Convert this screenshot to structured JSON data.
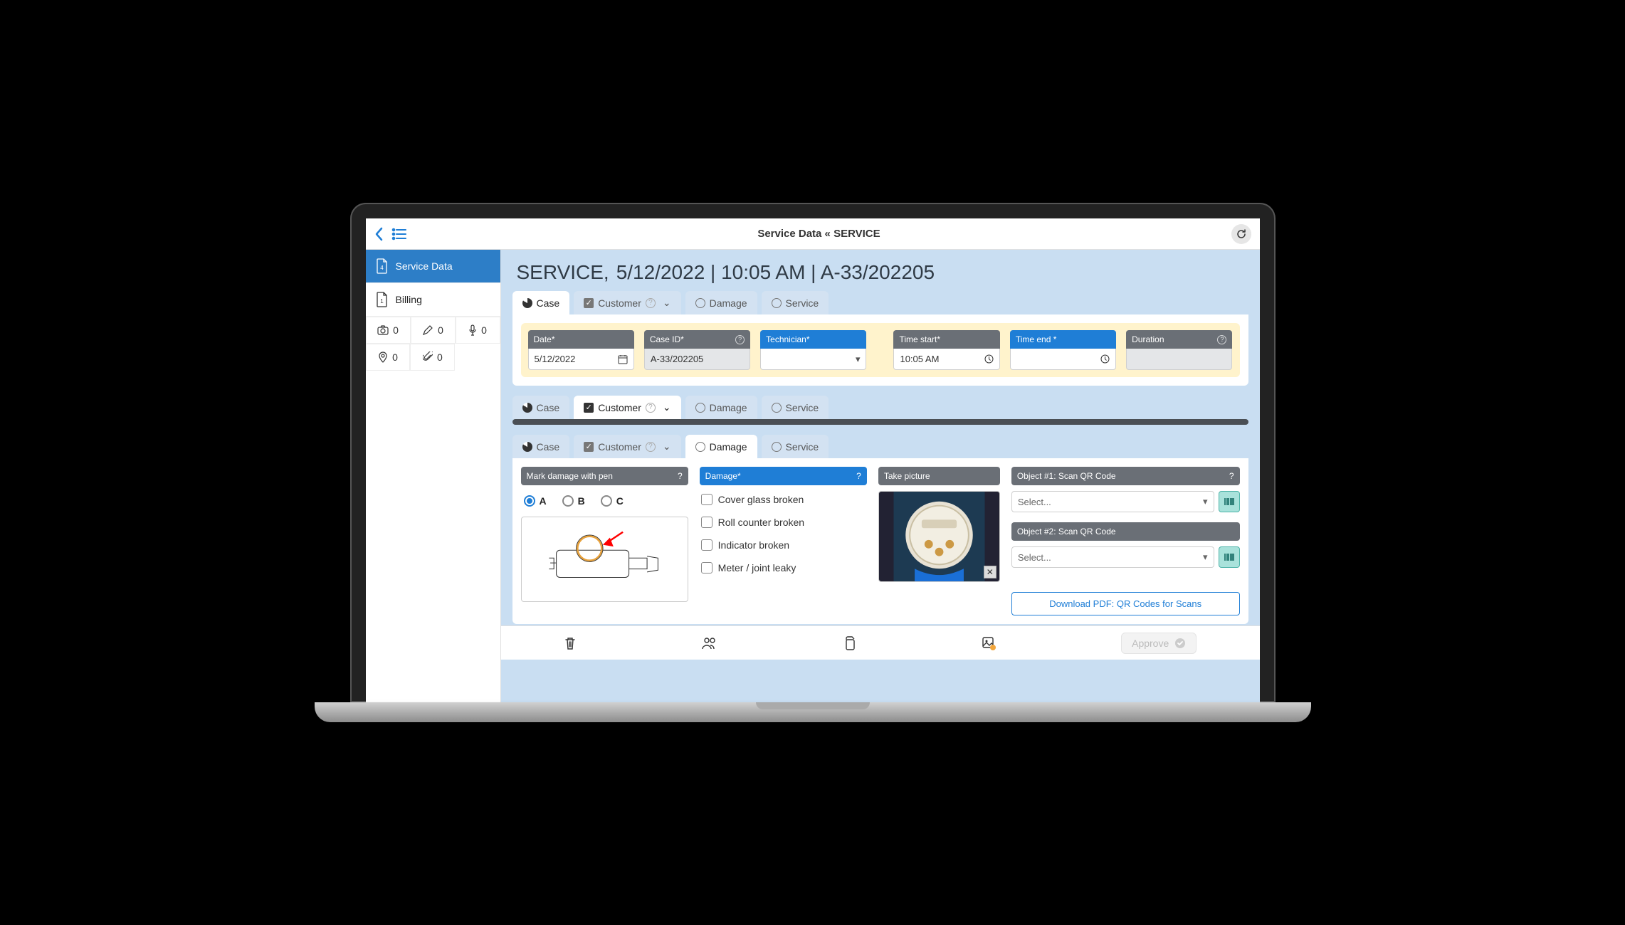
{
  "header": {
    "title": "Service Data « SERVICE"
  },
  "sidebar": {
    "items": [
      {
        "label": "Service Data",
        "doc_badge": "4"
      },
      {
        "label": "Billing",
        "doc_badge": "1"
      }
    ],
    "counters": {
      "camera": "0",
      "pen": "0",
      "mic": "0",
      "pin": "0",
      "clip": "0"
    }
  },
  "page": {
    "title_strong": "SERVICE,",
    "title_rest": "5/12/2022 | 10:05 AM | A-33/202205"
  },
  "tabs": {
    "case": "Case",
    "customer": "Customer",
    "damage": "Damage",
    "service": "Service"
  },
  "case_fields": {
    "date": {
      "label": "Date*",
      "value": "5/12/2022"
    },
    "case_id": {
      "label": "Case ID*",
      "value": "A-33/202205"
    },
    "technician": {
      "label": "Technician*",
      "value": ""
    },
    "time_start": {
      "label": "Time start*",
      "value": "10:05 AM"
    },
    "time_end": {
      "label": "Time end *",
      "value": ""
    },
    "duration": {
      "label": "Duration",
      "value": ""
    }
  },
  "damage": {
    "mark_label": "Mark damage with pen",
    "mark_options": [
      "A",
      "B",
      "C"
    ],
    "damage_label": "Damage*",
    "checks": [
      "Cover glass broken",
      "Roll counter broken",
      "Indicator broken",
      "Meter / joint leaky"
    ],
    "picture_label": "Take picture",
    "qr1_label": "Object #1: Scan QR Code",
    "qr2_label": "Object #2: Scan QR Code",
    "select_placeholder": "Select...",
    "download_label": "Download PDF: QR Codes for Scans"
  },
  "bottom": {
    "approve": "Approve"
  }
}
